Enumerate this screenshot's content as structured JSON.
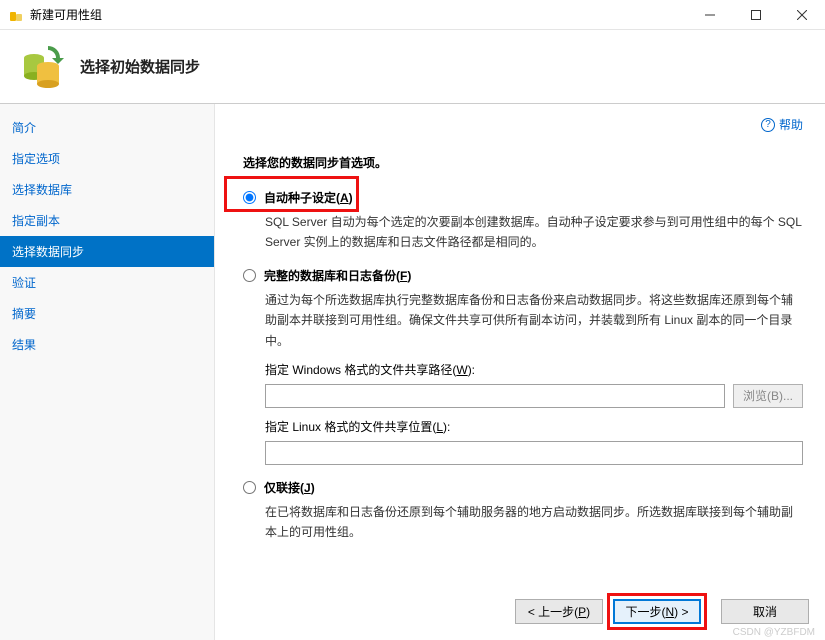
{
  "window": {
    "title": "新建可用性组"
  },
  "header": {
    "title": "选择初始数据同步"
  },
  "sidebar": {
    "items": [
      {
        "label": "简介"
      },
      {
        "label": "指定选项"
      },
      {
        "label": "选择数据库"
      },
      {
        "label": "指定副本"
      },
      {
        "label": "选择数据同步"
      },
      {
        "label": "验证"
      },
      {
        "label": "摘要"
      },
      {
        "label": "结果"
      }
    ]
  },
  "help": {
    "label": "帮助"
  },
  "content": {
    "instruction": "选择您的数据同步首选项。",
    "options": [
      {
        "label_pre": "自动种子设定(",
        "label_key": "A",
        "label_post": ")",
        "desc": "SQL Server 自动为每个选定的次要副本创建数据库。自动种子设定要求参与到可用性组中的每个 SQL Server 实例上的数据库和日志文件路径都是相同的。"
      },
      {
        "label_pre": "完整的数据库和日志备份(",
        "label_key": "F",
        "label_post": ")",
        "desc": "通过为每个所选数据库执行完整数据库备份和日志备份来启动数据同步。将这些数据库还原到每个辅助副本并联接到可用性组。确保文件共享可供所有副本访问，并装载到所有 Linux 副本的同一个目录中。",
        "win_path_label_pre": "指定 Windows 格式的文件共享路径(",
        "win_path_label_key": "W",
        "win_path_label_post": "):",
        "win_path_value": "",
        "browse_label": "浏览(B)...",
        "linux_path_label_pre": "指定 Linux 格式的文件共享位置(",
        "linux_path_label_key": "L",
        "linux_path_label_post": "):",
        "linux_path_value": ""
      },
      {
        "label_pre": "仅联接(",
        "label_key": "J",
        "label_post": ")",
        "desc": "在已将数据库和日志备份还原到每个辅助服务器的地方启动数据同步。所选数据库联接到每个辅助副本上的可用性组。"
      }
    ]
  },
  "buttons": {
    "prev_pre": "< 上一步(",
    "prev_key": "P",
    "prev_post": ")",
    "next_pre": "下一步(",
    "next_key": "N",
    "next_post": ") >",
    "cancel": "取消"
  },
  "watermark": "CSDN @YZBFDM"
}
